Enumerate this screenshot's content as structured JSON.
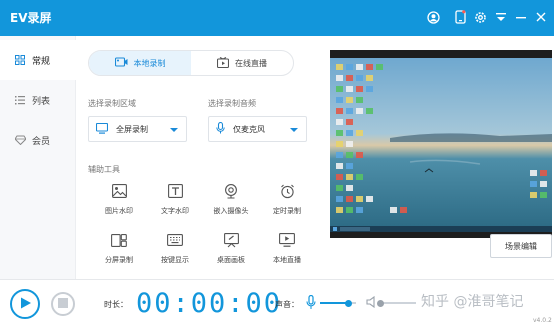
{
  "app": {
    "title": "EV录屏",
    "brand_color": "#1296db"
  },
  "titlebar": {
    "icons": [
      "user-icon",
      "mobile-icon",
      "settings-icon",
      "menu-icon",
      "minimize-icon",
      "close-icon"
    ]
  },
  "sidebar": {
    "items": [
      {
        "label": "常规",
        "icon": "grid-icon",
        "active": true
      },
      {
        "label": "列表",
        "icon": "list-icon",
        "active": false
      },
      {
        "label": "会员",
        "icon": "diamond-icon",
        "active": false
      }
    ]
  },
  "mode_tabs": [
    {
      "label": "本地录制",
      "icon": "video-icon",
      "active": true
    },
    {
      "label": "在线直播",
      "icon": "broadcast-icon",
      "active": false
    }
  ],
  "region": {
    "label": "选择录制区域",
    "value": "全屏录制"
  },
  "audio": {
    "label": "选择录制音频",
    "value": "仅麦克风"
  },
  "tools": {
    "label": "辅助工具",
    "items": [
      {
        "label": "图片水印",
        "icon": "image-icon"
      },
      {
        "label": "文字水印",
        "icon": "text-icon"
      },
      {
        "label": "嵌入摄像头",
        "icon": "camera-icon"
      },
      {
        "label": "定时录制",
        "icon": "clock-icon"
      },
      {
        "label": "分屏录制",
        "icon": "split-screen-icon"
      },
      {
        "label": "按键显示",
        "icon": "keyboard-icon"
      },
      {
        "label": "桌面画板",
        "icon": "whiteboard-icon"
      },
      {
        "label": "本地直播",
        "icon": "monitor-play-icon"
      }
    ]
  },
  "preview": {
    "scene_button": "场景编辑"
  },
  "bottombar": {
    "duration_label": "时长：",
    "timer": "00:00:00",
    "sound_label": "声音：",
    "mic_level": 0.8,
    "speaker_level": 0.0,
    "watermark": "知乎 @淮哥笔记",
    "version": "v4.0.2"
  }
}
